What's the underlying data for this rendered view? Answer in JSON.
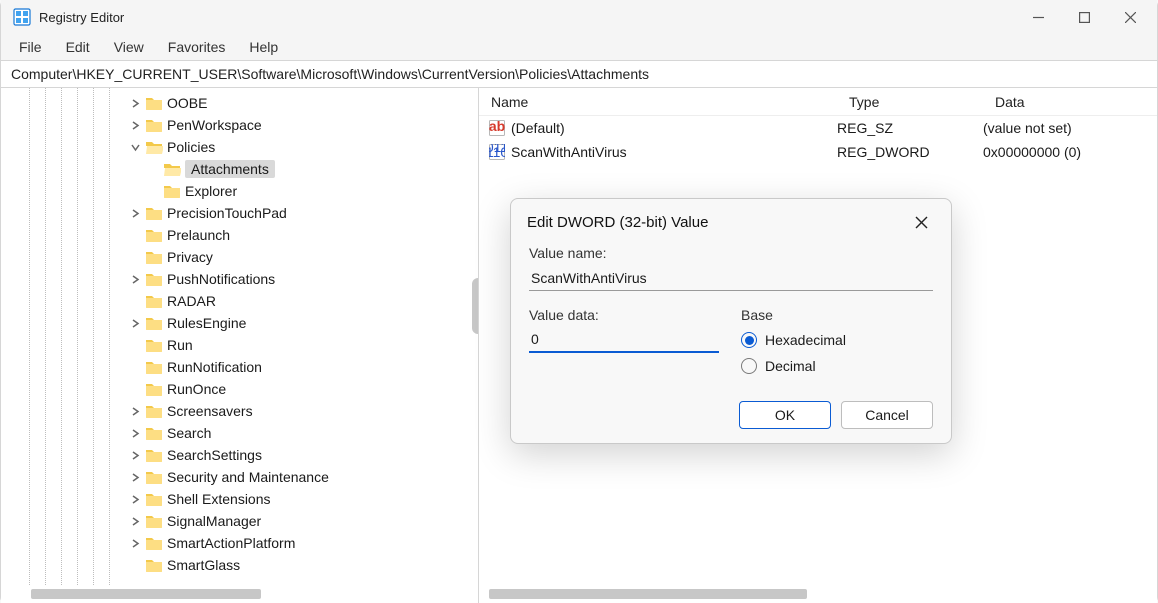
{
  "window": {
    "title": "Registry Editor"
  },
  "menu": {
    "file": "File",
    "edit": "Edit",
    "view": "View",
    "favorites": "Favorites",
    "help": "Help"
  },
  "path": "Computer\\HKEY_CURRENT_USER\\Software\\Microsoft\\Windows\\CurrentVersion\\Policies\\Attachments",
  "tree": [
    {
      "indent": 7,
      "expander": "right",
      "open": false,
      "label": "OOBE"
    },
    {
      "indent": 7,
      "expander": "right",
      "open": false,
      "label": "PenWorkspace"
    },
    {
      "indent": 7,
      "expander": "down",
      "open": true,
      "label": "Policies"
    },
    {
      "indent": 8,
      "expander": "none",
      "open": true,
      "label": "Attachments",
      "selected": true
    },
    {
      "indent": 8,
      "expander": "none",
      "open": false,
      "label": "Explorer"
    },
    {
      "indent": 7,
      "expander": "right",
      "open": false,
      "label": "PrecisionTouchPad"
    },
    {
      "indent": 7,
      "expander": "none",
      "open": false,
      "label": "Prelaunch"
    },
    {
      "indent": 7,
      "expander": "none",
      "open": false,
      "label": "Privacy"
    },
    {
      "indent": 7,
      "expander": "right",
      "open": false,
      "label": "PushNotifications"
    },
    {
      "indent": 7,
      "expander": "none",
      "open": false,
      "label": "RADAR"
    },
    {
      "indent": 7,
      "expander": "right",
      "open": false,
      "label": "RulesEngine"
    },
    {
      "indent": 7,
      "expander": "none",
      "open": false,
      "label": "Run"
    },
    {
      "indent": 7,
      "expander": "none",
      "open": false,
      "label": "RunNotification"
    },
    {
      "indent": 7,
      "expander": "none",
      "open": false,
      "label": "RunOnce"
    },
    {
      "indent": 7,
      "expander": "right",
      "open": false,
      "label": "Screensavers"
    },
    {
      "indent": 7,
      "expander": "right",
      "open": false,
      "label": "Search"
    },
    {
      "indent": 7,
      "expander": "right",
      "open": false,
      "label": "SearchSettings"
    },
    {
      "indent": 7,
      "expander": "right",
      "open": false,
      "label": "Security and Maintenance"
    },
    {
      "indent": 7,
      "expander": "right",
      "open": false,
      "label": "Shell Extensions"
    },
    {
      "indent": 7,
      "expander": "right",
      "open": false,
      "label": "SignalManager"
    },
    {
      "indent": 7,
      "expander": "right",
      "open": false,
      "label": "SmartActionPlatform"
    },
    {
      "indent": 7,
      "expander": "none",
      "open": false,
      "label": "SmartGlass"
    }
  ],
  "columns": {
    "name": "Name",
    "type": "Type",
    "data": "Data"
  },
  "values": [
    {
      "icon": "ab",
      "name": "(Default)",
      "type": "REG_SZ",
      "data": "(value not set)"
    },
    {
      "icon": "bin",
      "name": "ScanWithAntiVirus",
      "type": "REG_DWORD",
      "data": "0x00000000 (0)"
    }
  ],
  "dialog": {
    "title": "Edit DWORD (32-bit) Value",
    "valueNameLabel": "Value name:",
    "valueName": "ScanWithAntiVirus",
    "valueDataLabel": "Value data:",
    "valueData": "0",
    "baseLabel": "Base",
    "hexLabel": "Hexadecimal",
    "decLabel": "Decimal",
    "ok": "OK",
    "cancel": "Cancel"
  }
}
